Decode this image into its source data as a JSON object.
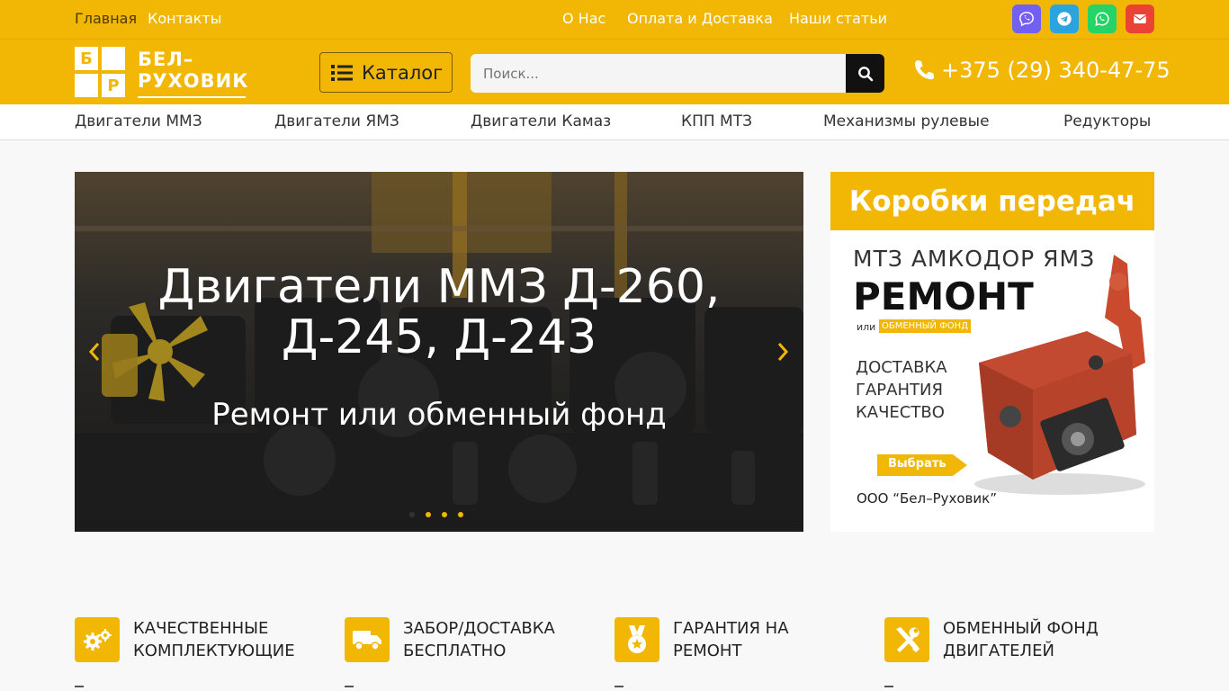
{
  "topbar": {
    "links_left": [
      "Главная",
      "Контакты"
    ],
    "links_right": [
      "О Нас",
      "Оплата и Доставка",
      "Наши статьи"
    ],
    "socials": [
      {
        "name": "viber",
        "color": "#7360f2"
      },
      {
        "name": "telegram",
        "color": "#2aa3df"
      },
      {
        "name": "whatsapp",
        "color": "#25d366"
      },
      {
        "name": "email",
        "color": "#ea4335"
      }
    ]
  },
  "header": {
    "logo": {
      "letters": [
        "Б",
        "Р"
      ],
      "name_line1": "БЕЛ–",
      "name_line2": "РУХОВИК"
    },
    "catalog_label": "Каталог",
    "search_placeholder": "Поиск...",
    "phone": "+375 (29) 340-47-75"
  },
  "nav": {
    "items": [
      "Двигатели ММЗ",
      "Двигатели ЯМЗ",
      "Двигатели Камаз",
      "КПП МТЗ",
      "Механизмы рулевые",
      "Редукторы"
    ]
  },
  "slider": {
    "title_line1": "Двигатели ММЗ Д-260,",
    "title_line2": "Д-245, Д-243",
    "subtitle": "Ремонт или обменный фонд",
    "dots_count": 4,
    "active_dot": 0
  },
  "banner": {
    "title": "Коробки передач",
    "brands": "МТЗ АМКОДОР ЯМЗ",
    "headline": "РЕМОНТ",
    "or": "или",
    "fund": "ОБМЕННЫЙ ФОНД",
    "features": [
      "ДОСТАВКА",
      "ГАРАНТИЯ",
      "КАЧЕСТВО"
    ],
    "button": "Выбрать",
    "company": "ООО “Бел–Руховик”"
  },
  "features": [
    {
      "line1": "КАЧЕСТВЕННЫЕ",
      "line2": "КОМПЛЕКТУЮЩИЕ",
      "icon": "gears-icon"
    },
    {
      "line1": "ЗАБОР/ДОСТАВКА",
      "line2": "БЕСПЛАТНО",
      "icon": "truck-icon"
    },
    {
      "line1": "ГАРАНТИЯ НА",
      "line2": "РЕМОНТ",
      "icon": "medal-icon"
    },
    {
      "line1": "ОБМЕННЫЙ ФОНД",
      "line2": "ДВИГАТЕЛЕЙ",
      "icon": "tools-icon"
    }
  ],
  "colors": {
    "accent": "#f2b705",
    "dark": "#111111"
  }
}
